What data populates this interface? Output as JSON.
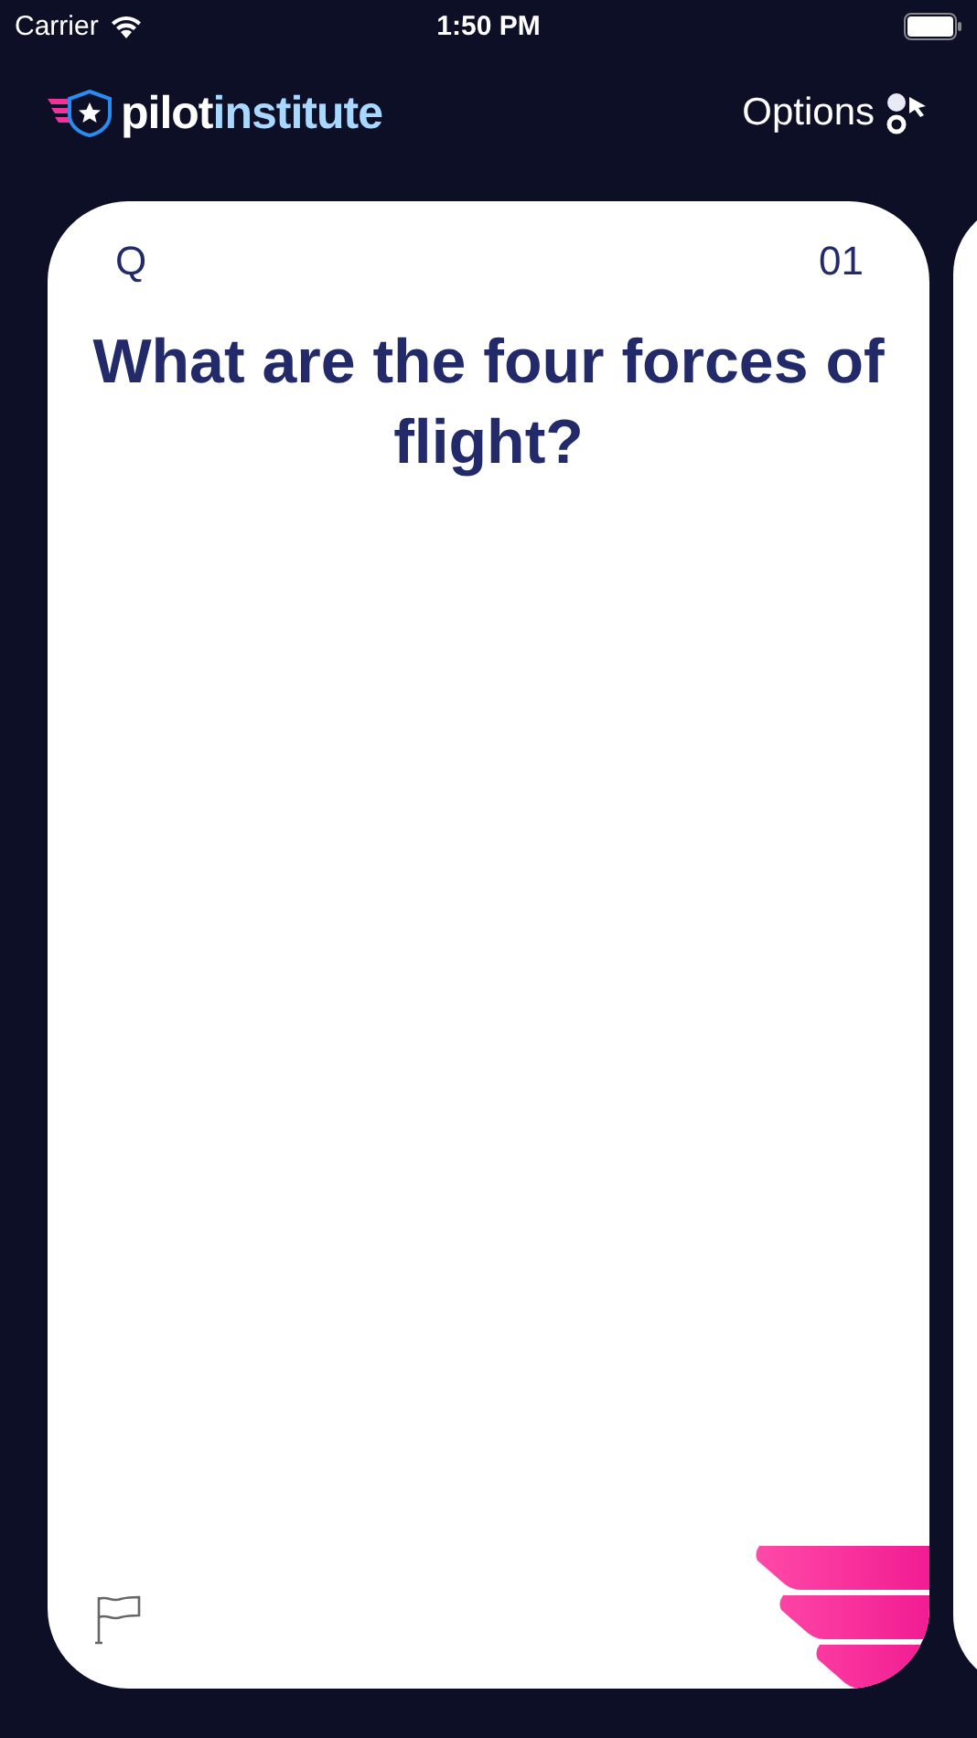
{
  "status_bar": {
    "carrier": "Carrier",
    "time": "1:50 PM"
  },
  "header": {
    "logo_first": "pilot",
    "logo_second": "institute",
    "options_label": "Options"
  },
  "card": {
    "side": "Q",
    "number": "01",
    "question": "What are the four forces of flight?",
    "flagged": false
  }
}
